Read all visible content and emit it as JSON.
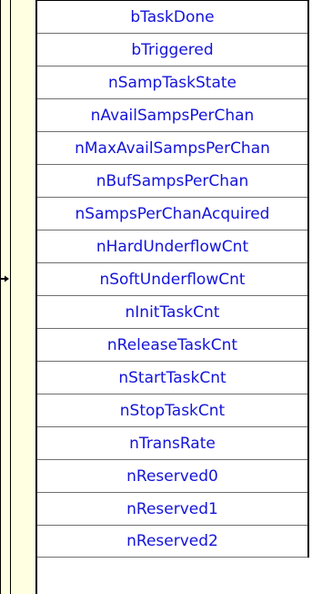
{
  "watch_panel": {
    "current_row_index": 8,
    "rows": [
      {
        "label": "bTaskDone"
      },
      {
        "label": "bTriggered"
      },
      {
        "label": "nSampTaskState"
      },
      {
        "label": "nAvailSampsPerChan"
      },
      {
        "label": "nMaxAvailSampsPerChan"
      },
      {
        "label": "nBufSampsPerChan"
      },
      {
        "label": "nSampsPerChanAcquired"
      },
      {
        "label": "nHardUnderflowCnt"
      },
      {
        "label": "nSoftUnderflowCnt"
      },
      {
        "label": "nInitTaskCnt"
      },
      {
        "label": "nReleaseTaskCnt"
      },
      {
        "label": "nStartTaskCnt"
      },
      {
        "label": "nStopTaskCnt"
      },
      {
        "label": "nTransRate"
      },
      {
        "label": "nReserved0"
      },
      {
        "label": "nReserved1"
      },
      {
        "label": "nReserved2"
      }
    ]
  },
  "colors": {
    "label_text": "#1414d9",
    "gutter_background": "#ffffe1",
    "grid_line": "#6f6f6f"
  },
  "icons": {
    "current_row_marker": "arrow-right-icon"
  }
}
